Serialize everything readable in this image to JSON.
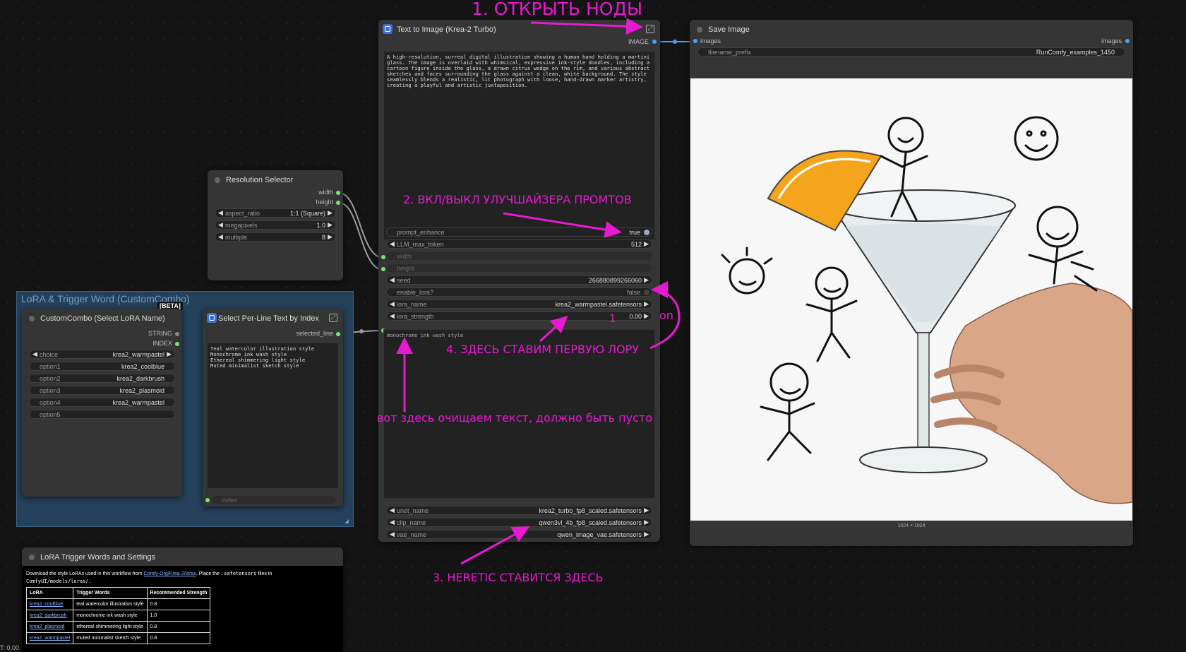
{
  "text_to_image": {
    "title": "Text to Image (Krea-2 Turbo)",
    "output": "IMAGE",
    "prompt": "A high-resolution, surreal digital illustration showing a human hand holding a martini glass. The image is overlaid with whimsical, expressive ink-style doodles, including a cartoon figure inside the glass, a drawn citrus wedge on the rim, and various abstract sketches and faces surrounding the glass against a clean, white background. The style seamlessly blends a realistic, lit photograph with loose, hand-drawn marker artistry, creating a playful and artistic juxtaposition.",
    "prompt_enhance_label": "prompt_enhance",
    "prompt_enhance_value": "true",
    "llm_max_token_label": "LLM_max_token",
    "llm_max_token_value": "512",
    "width_label": "width",
    "height_label": "height",
    "seed_label": "seed",
    "seed_value": "266880899266060",
    "enable_lora_label": "enable_lora?",
    "enable_lora_value": "false",
    "lora_name_label": "lora_name",
    "lora_name_value": "krea2_warmpastel.safetensors",
    "lora_strength_label": "lora_strength",
    "lora_strength_value": "0.00",
    "style_text": "monochrome ink wash style",
    "unet_label": "unet_name",
    "unet_value": "krea2_turbo_fp8_scaled.safetensors",
    "clip_label": "clip_name",
    "clip_value": "qwen3vl_4b_fp8_scaled.safetensors",
    "vae_label": "vae_name",
    "vae_value": "qwen_image_vae.safetensors"
  },
  "save_image": {
    "title": "Save Image",
    "input": "images",
    "output": "images",
    "filename_prefix_label": "filename_prefix",
    "filename_prefix_value": "RunComfy_examples_1450",
    "image_size": "1024 × 1024"
  },
  "resolution_selector": {
    "title": "Resolution Selector",
    "out_width": "width",
    "out_height": "height",
    "aspect_ratio_label": "aspect_ratio",
    "aspect_ratio_value": "1:1 (Square)",
    "megapixels_label": "megapixels",
    "megapixels_value": "1.0",
    "multiple_label": "multiple",
    "multiple_value": "8"
  },
  "group": {
    "title": "LoRA & Trigger Word (CustomCombo)",
    "badge": "[BETA]"
  },
  "custom_combo": {
    "title": "CustomCombo (Select LoRA Name)",
    "out_string": "STRING",
    "out_index": "INDEX",
    "choice_label": "choice",
    "choice_value": "krea2_warmpastel",
    "options": [
      {
        "label": "option1",
        "value": "krea2_coolblue"
      },
      {
        "label": "option2",
        "value": "krea2_darkbrush"
      },
      {
        "label": "option3",
        "value": "krea2_plasmoid"
      },
      {
        "label": "option4",
        "value": "krea2_warmpastel"
      },
      {
        "label": "option5",
        "value": ""
      }
    ]
  },
  "select_line": {
    "title": "Select Per-Line Text by Index",
    "output": "selected_line",
    "text": "Teal watercolor illustration style\nMonochrome ink wash style\nEthereal shimmering light style\nMuted minimalist sketch style",
    "index_label": "index"
  },
  "trigger_words": {
    "title": "LoRA Trigger Words and Settings",
    "intro_a": "Download the style LoRAs used in this workflow from ",
    "intro_link": "Comfy-Org/Krea-2/loras",
    "intro_b": ". Place the ",
    "intro_code": ".safetensors",
    "intro_c": " files in",
    "intro_path": "ComfyUI/models/loras/.",
    "headers": [
      "LoRA",
      "Trigger Words",
      "Recommended Strength"
    ],
    "rows": [
      [
        "krea2_coolblue",
        "teal watercolor illustration style",
        "0.8"
      ],
      [
        "krea2_darkbrush",
        "monochrome ink wash style",
        "1.0"
      ],
      [
        "krea2_plasmoid",
        "ethereal shimmering light style",
        "0.8"
      ],
      [
        "krea2_warmpastel",
        "muted minimalist sketch style",
        "0.8"
      ]
    ]
  },
  "annotations": {
    "a1": "1. ОТКРЫТЬ НОДЫ",
    "a2": "2. ВКЛ/ВЫКЛ УЛУЧШАЙЗЕРА ПРОМТОВ",
    "a3": "3. HERETIC СТАВИТСЯ ЗДЕСЬ",
    "a4": "4. ЗДЕСЬ СТАВИМ ПЕРВУЮ ЛОРУ",
    "a5": "вот здесь очищаем текст, должно быть пусто",
    "a_on": "on",
    "a_one": "1"
  },
  "corner_text": "T: 0.00",
  "colors": {
    "annotation": "#e61ad0",
    "link_blue": "#4a9eff",
    "port_green": "#7be37b"
  }
}
